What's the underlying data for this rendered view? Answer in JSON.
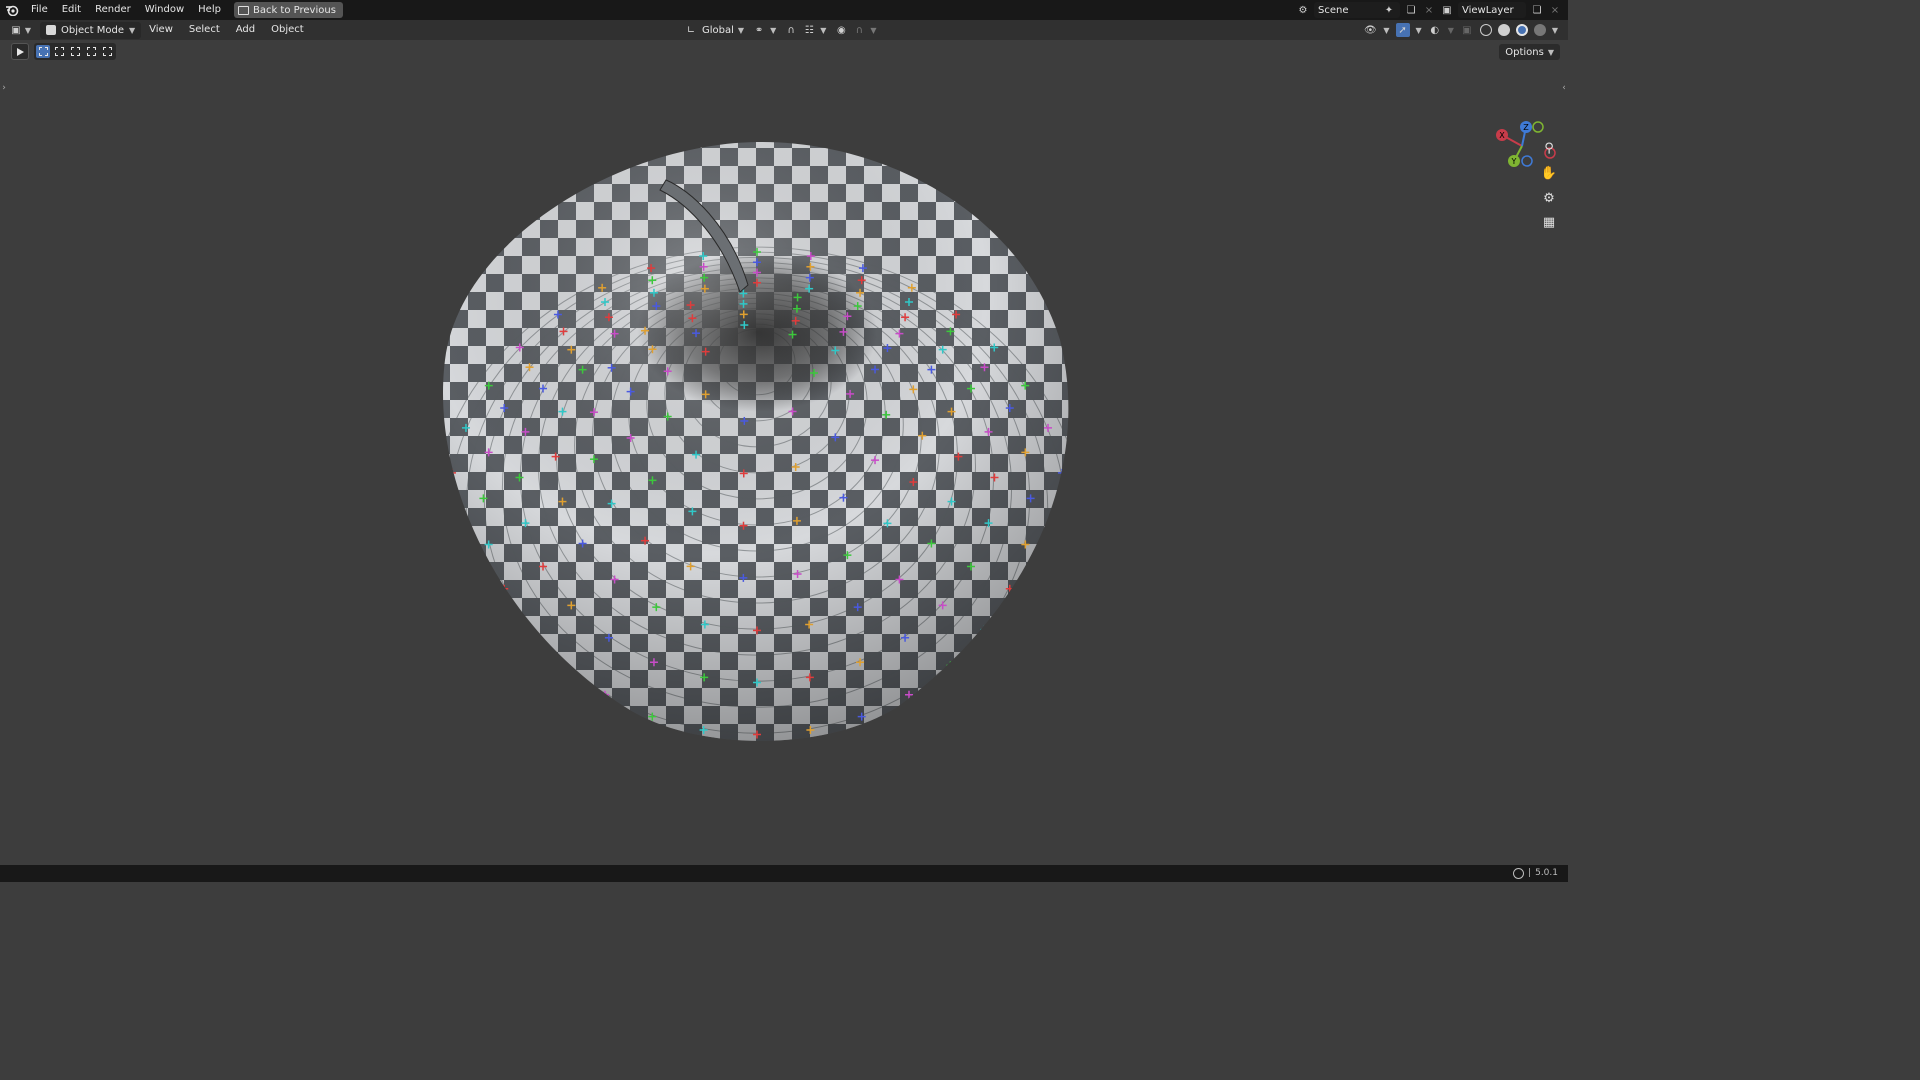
{
  "topbar": {
    "menus": [
      "File",
      "Edit",
      "Render",
      "Window",
      "Help"
    ],
    "back_button": "Back to Previous",
    "scene": "Scene",
    "view_layer": "ViewLayer"
  },
  "header": {
    "mode": "Object Mode",
    "menus": [
      "View",
      "Select",
      "Add",
      "Object"
    ],
    "transform_orientation": "Global"
  },
  "toolrow": {
    "options": "Options"
  },
  "gizmo": {
    "x": "X",
    "y": "Y",
    "z": "Z"
  },
  "statusbar": {
    "version": "5.0.1"
  },
  "colors": {
    "accent": "#4772b3",
    "axis_x": "#c83c4a",
    "axis_y": "#7fb532",
    "axis_z": "#3f7ad6",
    "background": "#3d3d3d"
  },
  "icons": {
    "logo": "blender-logo-icon",
    "zoom": "zoom-icon",
    "pan": "hand-icon",
    "camera": "camera-icon",
    "ortho": "grid-icon"
  }
}
